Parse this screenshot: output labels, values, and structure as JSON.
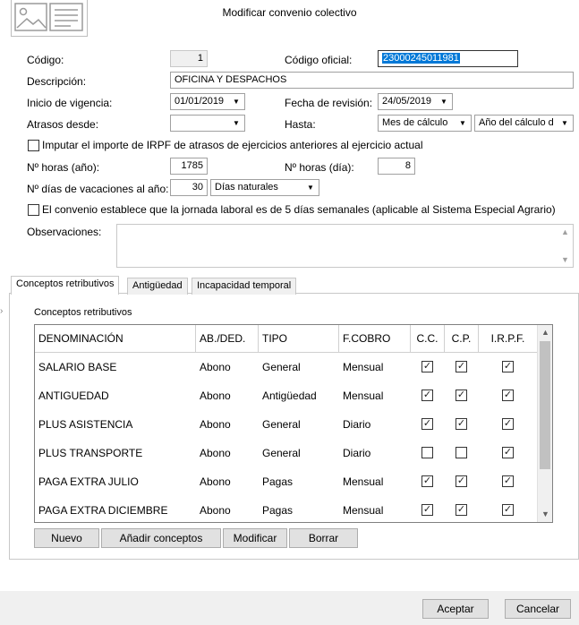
{
  "window": {
    "title": "Modificar convenio colectivo"
  },
  "form": {
    "codigo_label": "Código:",
    "codigo_value": "1",
    "codigo_oficial_label": "Código oficial:",
    "codigo_oficial_value": "23000245011981",
    "descripcion_label": "Descripción:",
    "descripcion_value": "OFICINA Y DESPACHOS",
    "inicio_label": "Inicio de vigencia:",
    "inicio_value": "01/01/2019",
    "revision_label": "Fecha de revisión:",
    "revision_value": "24/05/2019",
    "atrasos_label": "Atrasos desde:",
    "atrasos_value": "",
    "hasta_label": "Hasta:",
    "hasta_value1": "Mes de cálculo",
    "hasta_value2": "Año del cálculo d",
    "irpf_check_label": "Imputar el importe de IRPF de atrasos de ejercicios anteriores al ejercicio actual",
    "horas_anio_label": "Nº horas (año):",
    "horas_anio_value": "1785",
    "horas_dia_label": "Nº horas (día):",
    "horas_dia_value": "8",
    "vacaciones_label": "Nº días de vacaciones al año:",
    "vacaciones_value": "30",
    "vacaciones_tipo": "Días naturales",
    "jornada_check_label": "El convenio establece que la jornada laboral es de 5 días semanales (aplicable al Sistema Especial Agrario)",
    "observaciones_label": "Observaciones:"
  },
  "tabs": [
    {
      "label": "Conceptos retributivos"
    },
    {
      "label": "Antigüedad"
    },
    {
      "label": "Incapacidad temporal"
    }
  ],
  "panel": {
    "title": "Conceptos retributivos"
  },
  "table": {
    "headers": [
      "DENOMINACIÓN",
      "AB./DED.",
      "TIPO",
      "F.COBRO",
      "C.C.",
      "C.P.",
      "I.R.P.F."
    ],
    "rows": [
      {
        "denominacion": "SALARIO BASE",
        "abded": "Abono",
        "tipo": "General",
        "fcobro": "Mensual",
        "cc": true,
        "cp": true,
        "irpf": true
      },
      {
        "denominacion": "ANTIGUEDAD",
        "abded": "Abono",
        "tipo": "Antigüedad",
        "fcobro": "Mensual",
        "cc": true,
        "cp": true,
        "irpf": true
      },
      {
        "denominacion": "PLUS ASISTENCIA",
        "abded": "Abono",
        "tipo": "General",
        "fcobro": "Diario",
        "cc": true,
        "cp": true,
        "irpf": true
      },
      {
        "denominacion": "PLUS TRANSPORTE",
        "abded": "Abono",
        "tipo": "General",
        "fcobro": "Diario",
        "cc": false,
        "cp": false,
        "irpf": true
      },
      {
        "denominacion": "PAGA EXTRA JULIO",
        "abded": "Abono",
        "tipo": "Pagas",
        "fcobro": "Mensual",
        "cc": true,
        "cp": true,
        "irpf": true
      },
      {
        "denominacion": "PAGA EXTRA DICIEMBRE",
        "abded": "Abono",
        "tipo": "Pagas",
        "fcobro": "Mensual",
        "cc": true,
        "cp": true,
        "irpf": true
      }
    ]
  },
  "buttons": {
    "nuevo": "Nuevo",
    "anadir": "Añadir conceptos",
    "modificar": "Modificar",
    "borrar": "Borrar",
    "aceptar": "Aceptar",
    "cancelar": "Cancelar"
  },
  "colors": {
    "selection": "#0078d7",
    "footer": "#f0f0f0"
  }
}
